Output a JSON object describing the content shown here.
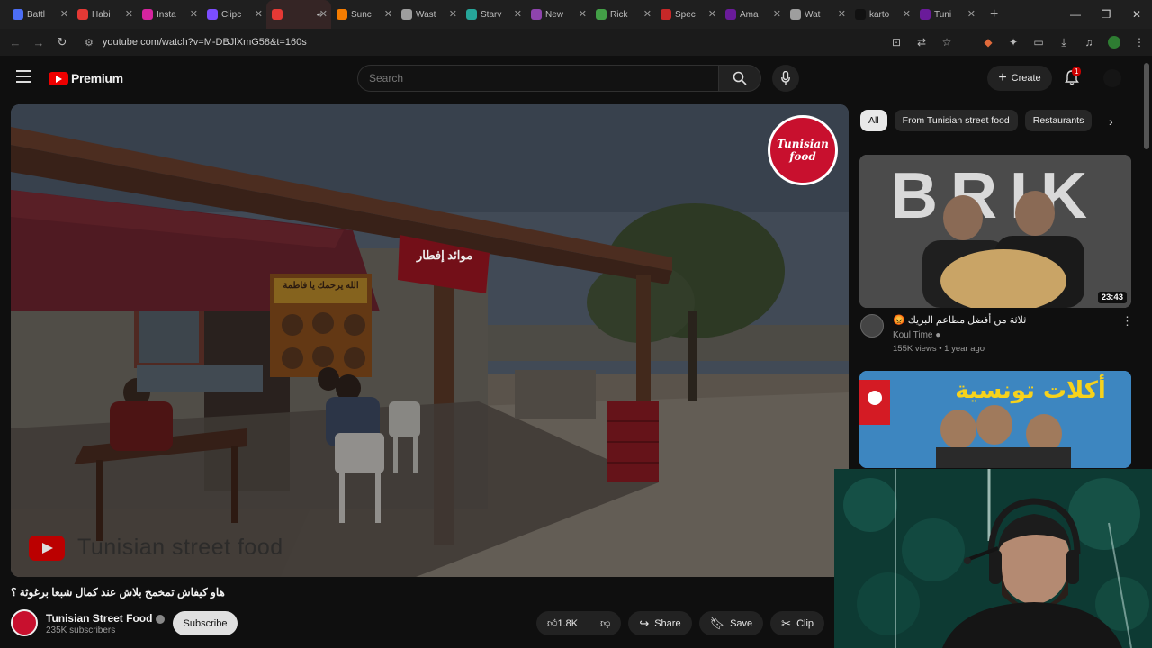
{
  "browser": {
    "tabs": [
      {
        "label": "Battl",
        "color": "#4c6ef5"
      },
      {
        "label": "Habi",
        "color": "#e53935"
      },
      {
        "label": "Insta",
        "color": "#d6249f"
      },
      {
        "label": "Clipc",
        "color": "#7c4dff"
      },
      {
        "label": "",
        "color": "#e53935"
      },
      {
        "label": "Sunc",
        "color": "#f57c00"
      },
      {
        "label": "Wast",
        "color": "#9e9e9e"
      },
      {
        "label": "Starv",
        "color": "#26a69a"
      },
      {
        "label": "New",
        "color": "#8e44ad"
      },
      {
        "label": "Rick",
        "color": "#43a047"
      },
      {
        "label": "Spec",
        "color": "#c62828"
      },
      {
        "label": "Ama",
        "color": "#6a1b9a"
      },
      {
        "label": "Wat",
        "color": "#9e9e9e"
      },
      {
        "label": "karto",
        "color": "#111111"
      },
      {
        "label": "Tuni",
        "color": "#6a1b9a"
      }
    ],
    "url": "youtube.com/watch?v=M-DBJlXmG58&t=160s"
  },
  "header": {
    "brand": "Premium",
    "search_placeholder": "Search",
    "create_label": "Create",
    "notification_count": "1"
  },
  "video": {
    "watermark_text": "Tunisian street food",
    "badge_line1": "Tunisian",
    "badge_line2": "food",
    "sign_text": "موائد إفطار",
    "menu_text": "الله يرحمك يا فاطمة",
    "title": "هاو كيفاش تمخمخ بلاش عند كمال شبعا برغوثة ؟",
    "channel_name": "Tunisian Street Food",
    "subscribers": "235K subscribers",
    "subscribe_label": "Subscribe",
    "likes": "1.8K",
    "share_label": "Share",
    "save_label": "Save",
    "clip_label": "Clip"
  },
  "chips": [
    "All",
    "From Tunisian street food",
    "Restaurants"
  ],
  "recommendations": [
    {
      "thumb_text": "BRIK",
      "duration": "23:43",
      "title": "ثلاثة من أفضل مطاعم البريك 😡",
      "channel": "Koul Time",
      "stats": "155K views • 1 year ago"
    },
    {
      "thumb_text": "أكلات تونسية"
    }
  ]
}
